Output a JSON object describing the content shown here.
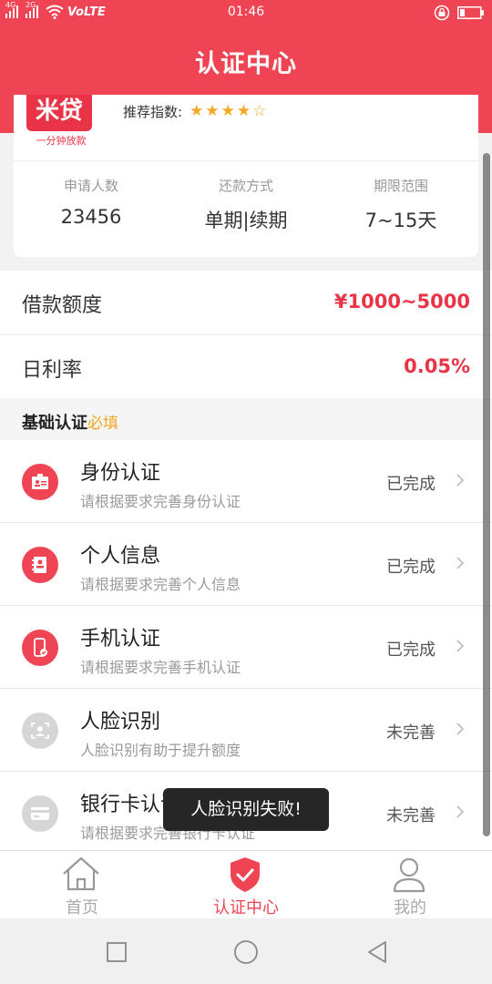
{
  "status_bar": {
    "signal_1": "4G",
    "signal_2": "2G",
    "network": "VoLTE",
    "time": "01:46",
    "icons": [
      "signal-icon",
      "wifi-icon",
      "lock-rotation-icon",
      "battery-icon"
    ]
  },
  "header": {
    "title": "认证中心"
  },
  "product": {
    "logo_text": "米贷",
    "logo_subtitle": "一分钟放款",
    "recommend_label": "推荐指数:",
    "rating": 4,
    "rating_max": 5
  },
  "stats": [
    {
      "label": "申请人数",
      "value": "23456"
    },
    {
      "label": "还款方式",
      "value": "单期|续期"
    },
    {
      "label": "期限范围",
      "value": "7~15天"
    }
  ],
  "loan_info": {
    "amount_label": "借款额度",
    "amount_value": "¥1000~5000",
    "rate_label": "日利率",
    "rate_value": "0.05%"
  },
  "section": {
    "title": "基础认证",
    "required_tag": "必填"
  },
  "certifications": [
    {
      "title": "身份认证",
      "desc": "请根据要求完善身份认证",
      "status": "已完成",
      "icon": "id-card-icon",
      "done": true
    },
    {
      "title": "个人信息",
      "desc": "请根据要求完善个人信息",
      "status": "已完成",
      "icon": "personal-info-icon",
      "done": true
    },
    {
      "title": "手机认证",
      "desc": "请根据要求完善手机认证",
      "status": "已完成",
      "icon": "phone-check-icon",
      "done": true
    },
    {
      "title": "人脸识别",
      "desc": "人脸识别有助于提升额度",
      "status": "未完善",
      "icon": "face-scan-icon",
      "done": false
    },
    {
      "title": "银行卡认证",
      "desc": "请根据要求完善银行卡认证",
      "status": "未完善",
      "icon": "bank-card-icon",
      "done": false
    }
  ],
  "toast": {
    "message": "人脸识别失败!"
  },
  "tabs": [
    {
      "label": "首页",
      "icon": "home-icon",
      "active": false
    },
    {
      "label": "认证中心",
      "icon": "shield-check-icon",
      "active": true
    },
    {
      "label": "我的",
      "icon": "user-icon",
      "active": false
    }
  ],
  "colors": {
    "primary": "#ef4453",
    "star": "#f5a623",
    "inactive": "#d6d6d6"
  }
}
